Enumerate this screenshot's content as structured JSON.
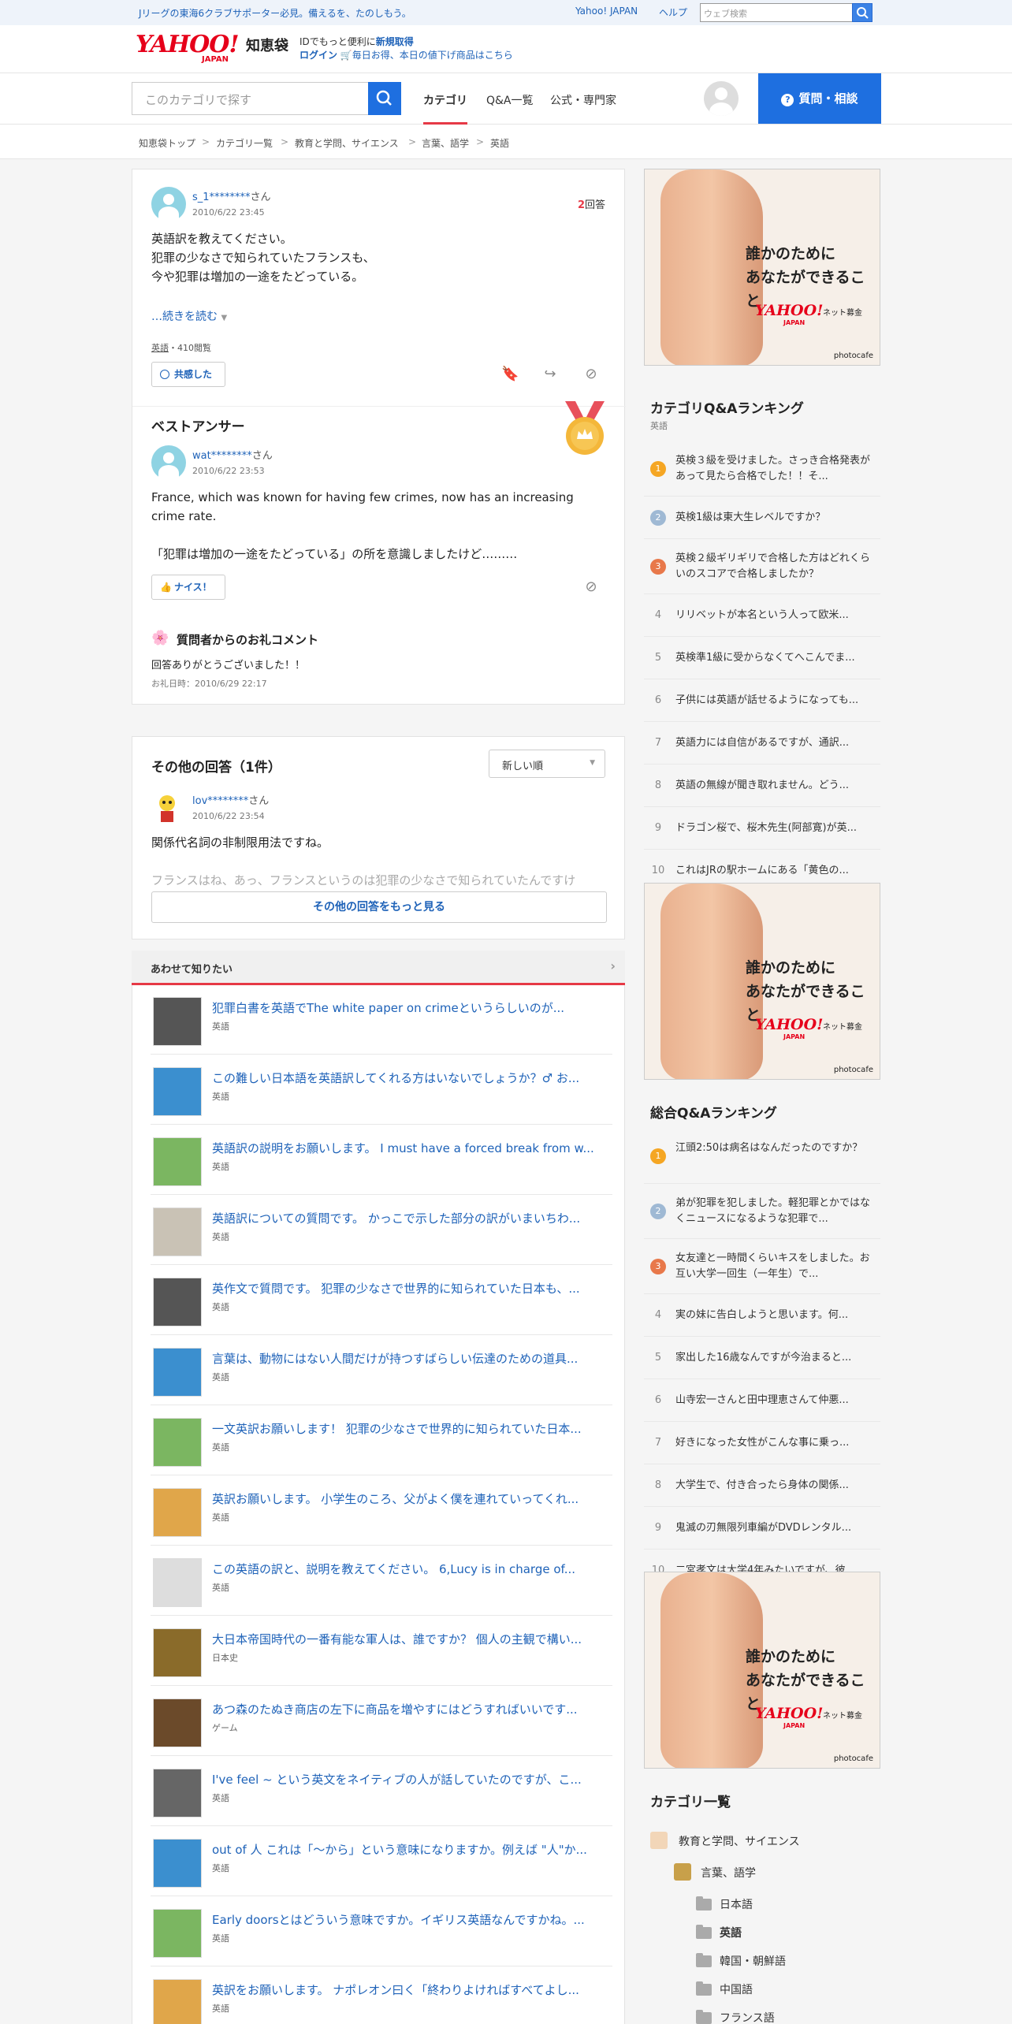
{
  "topbar": {
    "promo": "Jリーグの東海6クラブサポーター必見。備えるを、たのしもう。",
    "yahoo_japan": "Yahoo! JAPAN",
    "help": "ヘルプ",
    "search_placeholder": "ウェブ検索"
  },
  "header": {
    "logo": "YAHOO!",
    "logo_sub": "JAPAN",
    "service": "知恵袋",
    "line1_prefix": "IDでもっと便利に",
    "line1_link": "新規取得",
    "line2_login": "ログイン",
    "line2_text": "毎日お得、本日の値下げ商品はこちら"
  },
  "nav": {
    "search_placeholder": "このカテゴリで探す",
    "tabs": [
      "カテゴリ",
      "Q&A一覧",
      "公式・専門家"
    ],
    "ask_button": "質問・相談"
  },
  "breadcrumb": [
    "知恵袋トップ",
    "カテゴリ一覧",
    "教育と学問、サイエンス",
    "言葉、語学",
    "英語"
  ],
  "question": {
    "user": "s_1********",
    "san": "さん",
    "date": "2010/6/22 23:45",
    "answer_count": "2",
    "answer_label": "回答",
    "lines": [
      "英語訳を教えてください。",
      "犯罪の少なさで知られていたフランスも、",
      "今や犯罪は増加の一途をたどっている。"
    ],
    "more": "…続きを読む",
    "tag": "英語",
    "views": "・410閲覧",
    "empathy_button": "共感した"
  },
  "best_answer": {
    "heading": "ベストアンサー",
    "user": "wat********",
    "san": "さん",
    "date": "2010/6/22 23:53",
    "text1": "France, which was known for having few crimes, now has an increasing crime rate.",
    "text2": "「犯罪は増加の一途をたどっている」の所を意識しましたけど………",
    "nice_button": "ナイス！"
  },
  "thanks": {
    "heading": "質問者からのお礼コメント",
    "text": "回答ありがとうございました！！",
    "date": "お礼日時：2010/6/29 22:17"
  },
  "other_answers": {
    "heading": "その他の回答（1件）",
    "sort": "新しい順",
    "user": "lov********",
    "san": "さん",
    "date": "2010/6/22 23:54",
    "text1": "関係代名詞の非制限用法ですね。",
    "text2": "フランスはね、あっ、フランスというのは犯罪の少なさで知られていたんですけ",
    "more_button": "その他の回答をもっと見る"
  },
  "related": {
    "heading": "あわせて知りたい",
    "items": [
      {
        "title": "犯罪白書を英語でThe white paper on crimeというらしいのが...",
        "cat": "英語"
      },
      {
        "title": "この難しい日本語を英語訳してくれる方はいないでしょうか？♂ お...",
        "cat": "英語"
      },
      {
        "title": "英語訳の説明をお願いします。 I must have a forced break from w...",
        "cat": "英語"
      },
      {
        "title": "英語訳についての質問です。 かっこで示した部分の訳がいまいちわ...",
        "cat": "英語"
      },
      {
        "title": "英作文で質問です。 犯罪の少なさで世界的に知られていた日本も、...",
        "cat": "英語"
      },
      {
        "title": "言葉は、動物にはない人間だけが持つすばらしい伝達のための道具...",
        "cat": "英語"
      },
      {
        "title": "一文英訳お願いします！ 犯罪の少なさで世界的に知られていた日本...",
        "cat": "英語"
      },
      {
        "title": "英訳お願いします。 小学生のころ、父がよく僕を連れていってくれ...",
        "cat": "英語"
      },
      {
        "title": "この英語の訳と、説明を教えてください。 6,Lucy is in charge of...",
        "cat": "英語"
      },
      {
        "title": "大日本帝国時代の一番有能な軍人は、誰ですか？ 個人の主観で構い...",
        "cat": "日本史"
      },
      {
        "title": "あつ森のたぬき商店の左下に商品を増やすにはどうすればいいです...",
        "cat": "ゲーム"
      },
      {
        "title": "I've feel ~ という英文をネイティブの人が話していたのですが、こ...",
        "cat": "英語"
      },
      {
        "title": "out of 人 これは「〜から」という意味になりますか。例えば \"人\"か...",
        "cat": "英語"
      },
      {
        "title": "Early doorsとはどういう意味ですか。イギリス英語なんですかね。...",
        "cat": "英語"
      },
      {
        "title": "英訳をお願いします。 ナポレオン曰く「終わりよければすべてよし...",
        "cat": "英語"
      }
    ]
  },
  "ad": {
    "copy_line1": "誰かのために",
    "copy_line2": "あなたができること",
    "logo": "YAHOO!",
    "logo_sub": "JAPAN",
    "bokin": "ネット募金",
    "credit": "photocafe"
  },
  "category_ranking": {
    "heading": "カテゴリQ&Aランキング",
    "sub": "英語",
    "items": [
      "英検３級を受けました。さっき合格発表があって見たら合格でした！！そ...",
      "英検1級は東大生レベルですか？",
      "英検２級ギリギリで合格した方はどれくらいのスコアで合格しましたか？",
      "リリベットが本名という人って欧米...",
      "英検準1級に受からなくてへこんでま...",
      "子供には英語が話せるようになっても...",
      "英語力には自信があるですが、通訳...",
      "英語の無線が聞き取れません。どう...",
      "ドラゴン桜で、桜木先生(阿部寛)が英...",
      "これはJRの駅ホームにある「黄色の..."
    ]
  },
  "overall_ranking": {
    "heading": "総合Q&Aランキング",
    "items": [
      "江頭2:50は病名はなんだったのですか？",
      "弟が犯罪を犯しました。軽犯罪とかではなくニュースになるような犯罪で...",
      "女友達と一時間くらいキスをしました。お互い大学一回生（一年生）で...",
      "実の妹に告白しようと思います。何...",
      "家出した16歳なんですが今治まると...",
      "山寺宏一さんと田中理恵さんて仲悪...",
      "好きになった女性がこんな事に乗っ...",
      "大学生で、付き合ったら身体の関係...",
      "鬼滅の刃無限列車編がDVDレンタル...",
      "二宮孝文は大学4年みたいですが、彼..."
    ]
  },
  "category_list": {
    "heading": "カテゴリ一覧",
    "root": "教育と学問、サイエンス",
    "parent": "言葉、語学",
    "children": [
      "日本語",
      "英語",
      "韓国・朝鮮語",
      "中国語",
      "フランス語"
    ]
  },
  "colors": {
    "accent": "#1e6fe0",
    "link": "#1e62b8",
    "brand_red": "#e6001a",
    "rank1": "#f5a623",
    "rank2": "#9fb9d4",
    "rank3": "#e8784a"
  }
}
